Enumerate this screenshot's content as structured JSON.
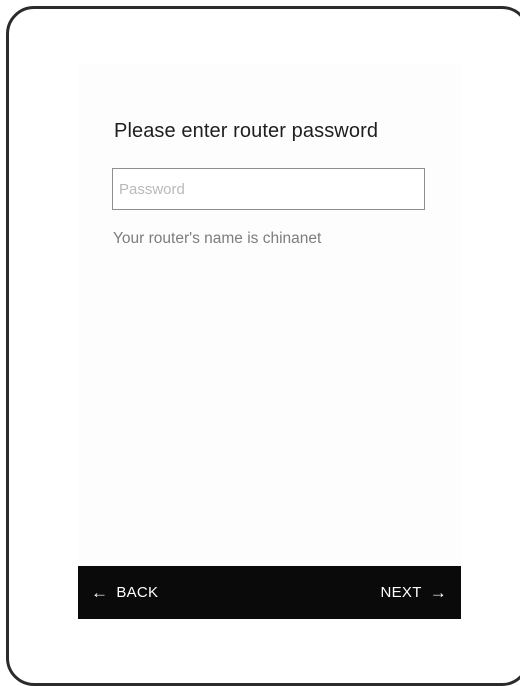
{
  "page": {
    "title": "Please enter router password",
    "hint": "Your router's name is chinanet"
  },
  "password": {
    "placeholder": "Password",
    "value": ""
  },
  "nav": {
    "back_label": "BACK",
    "back_icon": "←",
    "next_label": "NEXT",
    "next_icon": "→",
    "bar_color": "#0a0a0a"
  }
}
